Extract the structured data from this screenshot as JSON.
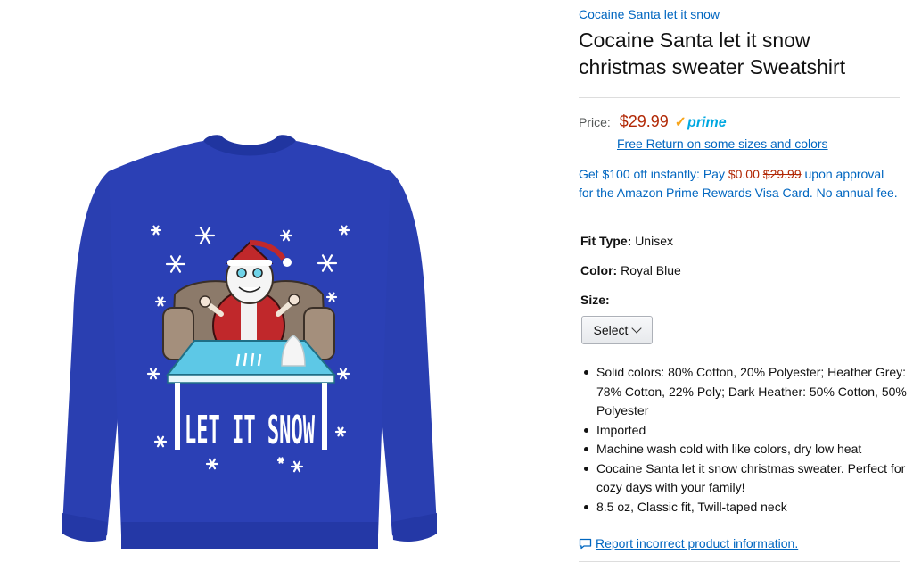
{
  "product_image": {
    "sweater_color": "#2a3fb1",
    "graphic_text": "LET IT SNOW"
  },
  "brand_link": "Cocaine Santa let it snow",
  "title": "Cocaine Santa let it snow christmas sweater Sweatshirt",
  "price": {
    "label": "Price:",
    "amount": "$29.99",
    "prime_check": "✓",
    "prime_label": "prime",
    "free_return": "Free Return on some sizes and colors"
  },
  "offer": {
    "part1": "Get $100 off instantly: Pay ",
    "pay_amount": "$0.00",
    "original_amount": "$29.99",
    "part2": " upon approval for the Amazon Prime Rewards Visa Card. No annual fee."
  },
  "fit_type": {
    "label": "Fit Type:",
    "value": "Unisex"
  },
  "color": {
    "label": "Color:",
    "value": "Royal Blue"
  },
  "size": {
    "label": "Size:",
    "selected": "Select"
  },
  "bullets": [
    "Solid colors: 80% Cotton, 20% Polyester; Heather Grey: 78% Cotton, 22% Poly; Dark Heather: 50% Cotton, 50% Polyester",
    "Imported",
    "Machine wash cold with like colors, dry low heat",
    "Cocaine Santa let it snow christmas sweater. Perfect for cozy days with your family!",
    "8.5 oz, Classic fit, Twill-taped neck"
  ],
  "report_link": "Report incorrect product information.",
  "colors": {
    "link": "#0066c0",
    "price": "#b12704",
    "prime": "#00a8e1"
  }
}
